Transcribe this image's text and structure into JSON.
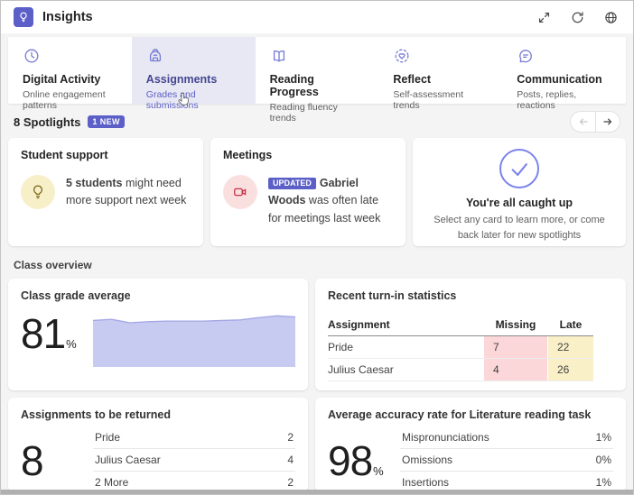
{
  "colors": {
    "accent": "#5b5fc7",
    "selected_tab_bg": "#e8e8f4",
    "chart_fill": "#c7caf1",
    "chart_line": "#a2a6e3",
    "missing_cell_bg": "#fcd7da",
    "late_cell_bg": "#faf0c8",
    "support_icon_bg": "#f7efc7",
    "meetings_icon_bg": "#fadfdf",
    "caught_up_accent": "#7b83eb"
  },
  "header": {
    "title": "Insights"
  },
  "tabs": [
    {
      "label": "Digital Activity",
      "sublabel": "Online engagement patterns",
      "selected": false
    },
    {
      "label": "Assignments",
      "sublabel": "Grades and submissions",
      "selected": true
    },
    {
      "label": "Reading Progress",
      "sublabel": "Reading fluency trends",
      "selected": false
    },
    {
      "label": "Reflect",
      "sublabel": "Self-assessment trends",
      "selected": false
    },
    {
      "label": "Communication",
      "sublabel": "Posts, replies, reactions",
      "selected": false
    }
  ],
  "spotlights": {
    "heading": "8 Spotlights",
    "new_badge": "1 NEW",
    "cards": [
      {
        "title": "Student support",
        "bold_text": "5 students",
        "text": " might need more support next week"
      },
      {
        "title": "Meetings",
        "badge": "UPDATED",
        "bold_text": "Gabriel Woods",
        "text": " was often late for meetings last week"
      },
      {
        "title": "You're all caught up",
        "subtitle": "Select any card to learn more, or come back later for new spotlights"
      }
    ]
  },
  "class_overview": {
    "section_title": "Class overview",
    "grade_average": {
      "title": "Class grade average",
      "value": "81",
      "unit": "%"
    },
    "turn_in": {
      "title": "Recent turn-in statistics",
      "columns": [
        "Assignment",
        "Missing",
        "Late"
      ],
      "rows": [
        {
          "assignment": "Pride",
          "missing": "7",
          "late": "22"
        },
        {
          "assignment": "Julius Caesar",
          "missing": "4",
          "late": "26"
        }
      ]
    },
    "to_be_returned": {
      "title": "Assignments to be returned",
      "value": "8",
      "rows": [
        {
          "label": "Pride",
          "value": "2"
        },
        {
          "label": "Julius Caesar",
          "value": "4"
        },
        {
          "label": "2 More",
          "value": "2"
        }
      ]
    },
    "accuracy": {
      "title": "Average accuracy rate for Literature reading task",
      "value": "98",
      "unit": "%",
      "rows": [
        {
          "label": "Mispronunciations",
          "value": "1%"
        },
        {
          "label": "Omissions",
          "value": "0%"
        },
        {
          "label": "Insertions",
          "value": "1%"
        }
      ]
    }
  },
  "chart_data": {
    "type": "area",
    "title": "Class grade average trend",
    "x": [
      1,
      2,
      3,
      4,
      5,
      6,
      7,
      8,
      9,
      10,
      11,
      12
    ],
    "values": [
      80,
      82,
      76,
      78,
      79,
      79,
      79,
      80,
      81,
      85,
      88,
      86
    ],
    "ylim": [
      0,
      90
    ],
    "xlabel": "",
    "ylabel": "",
    "grid": false,
    "legend": false
  }
}
